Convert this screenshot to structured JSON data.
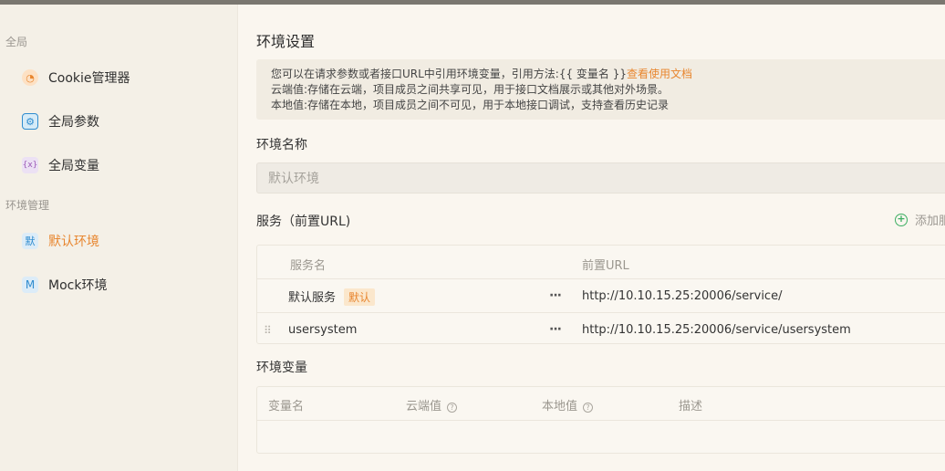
{
  "sidebar": {
    "section_global": "全局",
    "section_env": "环境管理",
    "items": [
      {
        "label": "Cookie管理器",
        "icon": "cookie-icon",
        "glyph": "◔"
      },
      {
        "label": "全局参数",
        "icon": "settings-icon",
        "glyph": "⚙"
      },
      {
        "label": "全局变量",
        "icon": "variable-icon",
        "glyph": "{x}"
      },
      {
        "label": "默认环境",
        "icon": "env-default-icon",
        "glyph": "默"
      },
      {
        "label": "Mock环境",
        "icon": "env-mock-icon",
        "glyph": "M"
      }
    ]
  },
  "main": {
    "title": "环境设置",
    "notice": {
      "line1": "您可以在请求参数或者接口URL中引用环境变量，引用方法:{{ 变量名 }}",
      "link": "查看使用文档",
      "line2": "云端值:存储在云端，项目成员之间共享可见，用于接口文档展示或其他对外场景。",
      "line3": "本地值:存储在本地，项目成员之间不可见，用于本地接口调试，支持查看历史记录"
    },
    "env_name_label": "环境名称",
    "env_name_placeholder": "默认环境",
    "services_label": "服务（前置URL)",
    "add_service": "添加服",
    "services_table": {
      "headers": [
        "服务名",
        "前置URL"
      ],
      "rows": [
        {
          "name": "默认服务",
          "badge": "默认",
          "url": "http://10.10.15.25:20006/service/"
        },
        {
          "name": "usersystem",
          "badge": "",
          "url": "http://10.10.15.25:20006/service/usersystem"
        }
      ]
    },
    "vars_label": "环境变量",
    "vars_table": {
      "headers": [
        "变量名",
        "云端值",
        "本地值",
        "描述"
      ]
    }
  },
  "colors": {
    "accent": "#e8862f",
    "add": "#3cae62"
  }
}
